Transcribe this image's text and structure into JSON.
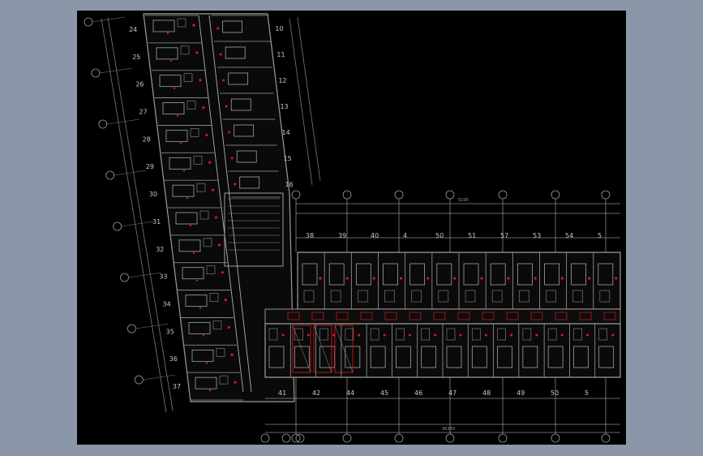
{
  "drawing": {
    "title": "CAD floor plan (hotel guestroom wing)",
    "background": "#000000",
    "app_background": "#8b97a9",
    "line_color": "#9a9a9a",
    "accent_color": "#e01818"
  },
  "wing_a": {
    "room_numbers_left": [
      "24",
      "25",
      "26",
      "27",
      "28",
      "29",
      "30",
      "31",
      "32",
      "33",
      "34",
      "35",
      "36",
      "37"
    ],
    "room_numbers_right": [
      "10",
      "11",
      "12",
      "13",
      "14",
      "15",
      "16"
    ]
  },
  "wing_b": {
    "top_room_numbers": [
      "38",
      "39",
      "40",
      "4",
      "50",
      "51",
      "57",
      "53",
      "54",
      "5"
    ],
    "bottom_room_numbers": [
      "41",
      "42",
      "44",
      "45",
      "46",
      "47",
      "48",
      "49",
      "50",
      "5"
    ],
    "top_overall_dim": "5100",
    "bottom_overall_dim": "36230"
  }
}
